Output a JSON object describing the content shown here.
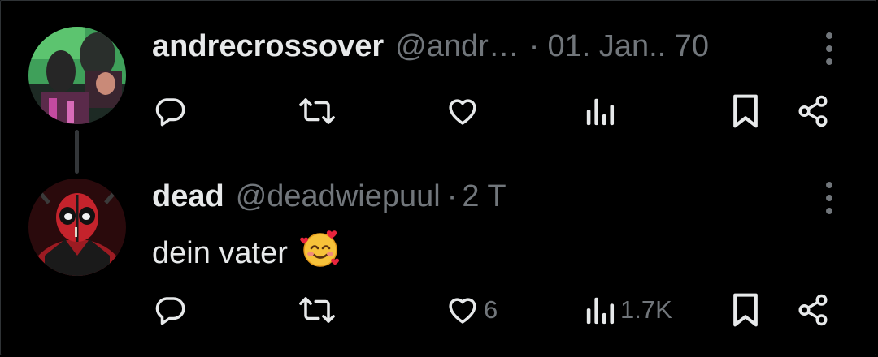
{
  "colors": {
    "background": "#000000",
    "primary_text": "#e7e9ea",
    "secondary_text": "#71767b",
    "thread_line": "#333639"
  },
  "tweets": [
    {
      "avatar": "photo-avatar",
      "display_name": "andrecrossover",
      "handle": "@andr…",
      "separator": "·",
      "timestamp": "01. Jan.. 70",
      "text": "",
      "actions": {
        "reply_icon": "reply-icon",
        "retweet_icon": "retweet-icon",
        "like_icon": "heart-icon",
        "like_count": "",
        "views_icon": "views-chart-icon",
        "views_count": "",
        "bookmark_icon": "bookmark-icon",
        "share_icon": "share-icon"
      }
    },
    {
      "avatar": "deadpool-avatar",
      "display_name": "dead",
      "handle": "@deadwiepuul",
      "separator": "·",
      "timestamp": "2 T",
      "text": "dein vater",
      "emoji": "🥰",
      "actions": {
        "reply_icon": "reply-icon",
        "retweet_icon": "retweet-icon",
        "like_icon": "heart-icon",
        "like_count": "6",
        "views_icon": "views-chart-icon",
        "views_count": "1.7K",
        "bookmark_icon": "bookmark-icon",
        "share_icon": "share-icon"
      }
    }
  ]
}
